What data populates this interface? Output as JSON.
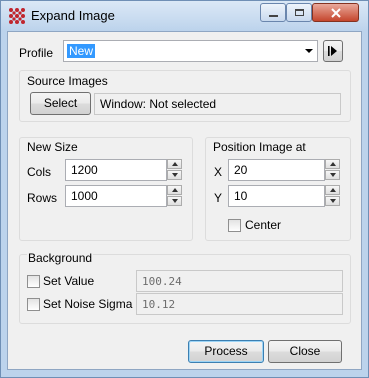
{
  "window": {
    "title": "Expand Image",
    "icon": "app-logo-icon"
  },
  "profile": {
    "label": "Profile",
    "value": "New"
  },
  "source": {
    "group_title": "Source Images",
    "select_label": "Select",
    "window_text": "Window: Not selected"
  },
  "new_size": {
    "group_title": "New Size",
    "cols_label": "Cols",
    "cols_value": "1200",
    "rows_label": "Rows",
    "rows_value": "1000"
  },
  "position": {
    "group_title": "Position Image at",
    "x_label": "X",
    "x_value": "20",
    "y_label": "Y",
    "y_value": "10",
    "center_label": "Center"
  },
  "background": {
    "group_title": "Background",
    "set_value_label": "Set Value",
    "set_value_value": "100.24",
    "noise_label": "Set Noise Sigma",
    "noise_value": "10.12"
  },
  "actions": {
    "process_label": "Process",
    "close_label": "Close"
  }
}
